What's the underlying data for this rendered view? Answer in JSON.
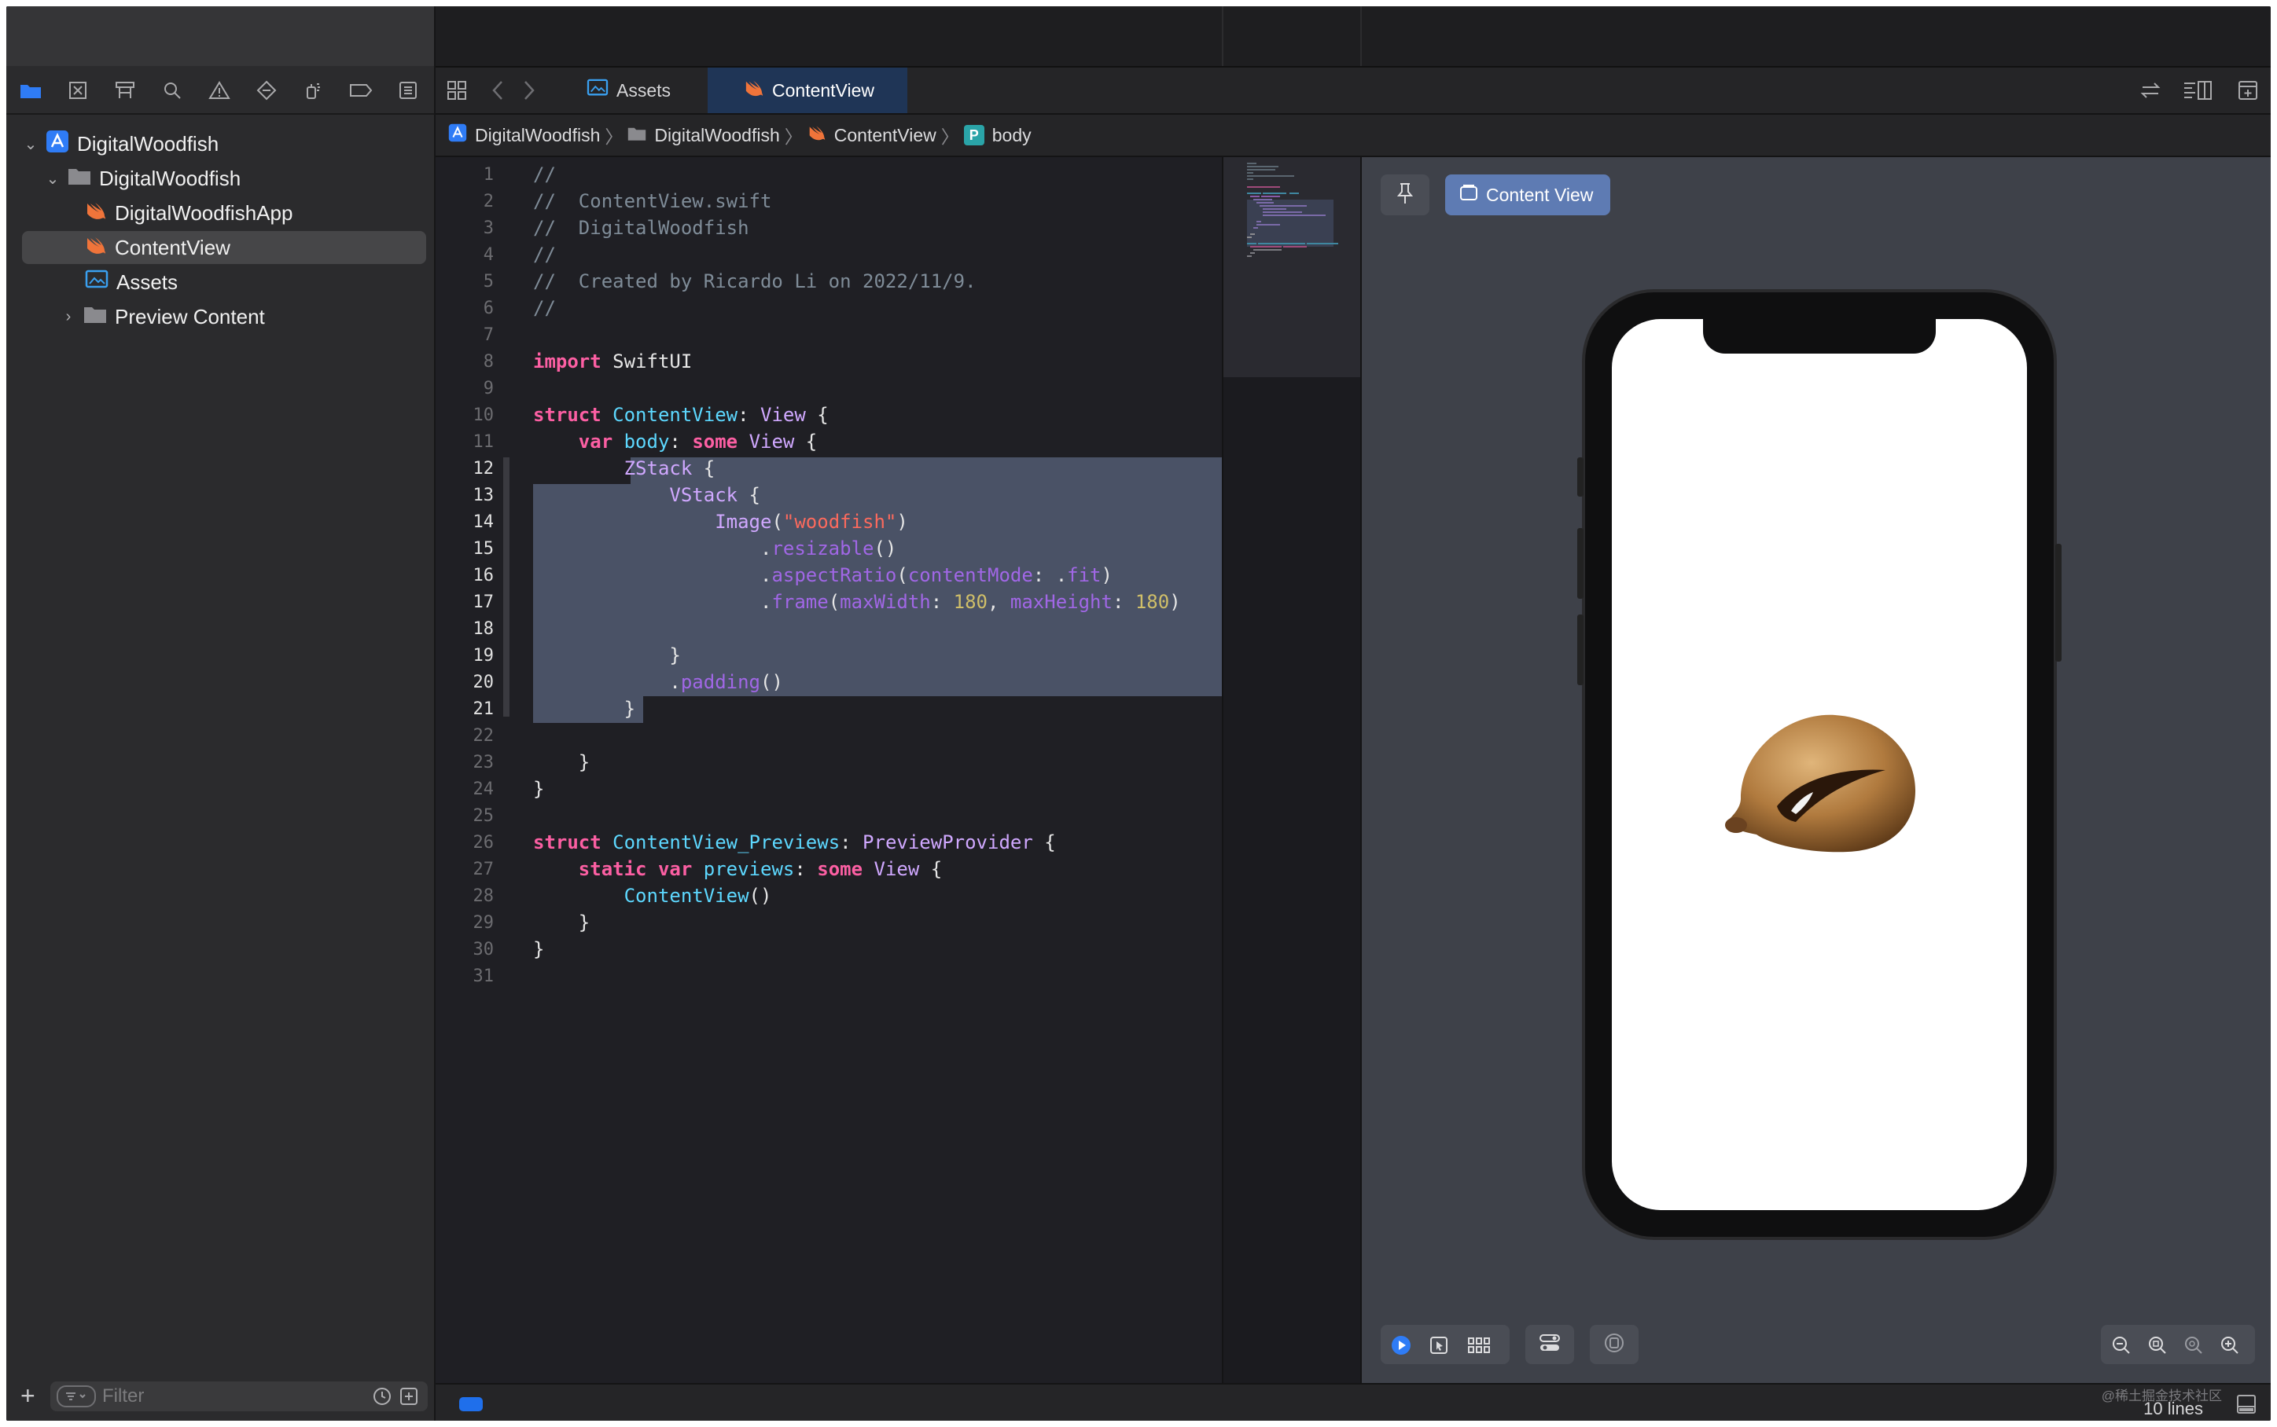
{
  "navigator": {
    "tools": [
      {
        "icon": "folder-icon",
        "symbol": "▬"
      },
      {
        "icon": "source-control-icon",
        "symbol": "⊠"
      },
      {
        "icon": "symbol-navigator-icon",
        "symbol": "⌸"
      },
      {
        "icon": "find-icon",
        "symbol": "⌕"
      },
      {
        "icon": "issue-warning-icon",
        "symbol": "⚠"
      },
      {
        "icon": "test-diamond-icon",
        "symbol": "◇"
      },
      {
        "icon": "debug-spray-icon",
        "symbol": "☄"
      },
      {
        "icon": "breakpoint-icon",
        "symbol": "▭"
      },
      {
        "icon": "report-icon",
        "symbol": "☰"
      }
    ],
    "tree": [
      {
        "label": "DigitalWoodfish",
        "icon": "project-icon",
        "chevron": "⌄"
      },
      {
        "label": "DigitalWoodfish",
        "icon": "folder-icon",
        "chevron": "⌄"
      },
      {
        "label": "DigitalWoodfishApp",
        "icon": "swift-file-icon",
        "chevron": ""
      },
      {
        "label": "ContentView",
        "icon": "swift-file-icon",
        "chevron": ""
      },
      {
        "label": "Assets",
        "icon": "asset-catalog-icon",
        "chevron": ""
      },
      {
        "label": "Preview Content",
        "icon": "folder-icon",
        "chevron": "›"
      }
    ],
    "filter_placeholder": "Filter",
    "add_symbol": "+"
  },
  "tabs": [
    {
      "label": "Assets",
      "icon": "asset-catalog-icon"
    },
    {
      "label": "ContentView",
      "icon": "swift-file-icon"
    }
  ],
  "jumpbar": {
    "items": [
      "DigitalWoodfish",
      "DigitalWoodfish",
      "ContentView",
      "body"
    ],
    "body_badge": "P",
    "separator": "〉"
  },
  "code": {
    "line_numbers": [
      "1",
      "2",
      "3",
      "4",
      "5",
      "6",
      "7",
      "8",
      "9",
      "10",
      "11",
      "12",
      "13",
      "14",
      "15",
      "16",
      "17",
      "18",
      "19",
      "20",
      "21",
      "22",
      "23",
      "24",
      "25",
      "26",
      "27",
      "28",
      "29",
      "30",
      "31"
    ],
    "tokens": {
      "l1": "//",
      "l2": "//  ContentView.swift",
      "l3": "//  DigitalWoodfish",
      "l4": "//",
      "l5": "//  Created by Ricardo Li on 2022/11/9.",
      "l6": "//",
      "import_kw": "import",
      "import_mod": " SwiftUI",
      "struct_kw": "struct",
      "cv_name": "ContentView",
      "colon": ":",
      "view_type": "View",
      "brace_open": " {",
      "var_kw": "var",
      "body_name": "body",
      "some_kw": "some",
      "zstack": "ZStack",
      "vstack": "VStack",
      "image_fn": "Image",
      "paren_open": "(",
      "woodfish_str": "\"woodfish\"",
      "paren_close": ")",
      "dot": ".",
      "resizable": "resizable",
      "call_empty": "()",
      "aspect_ratio": "aspectRatio",
      "content_mode": "contentMode",
      "fit": "fit",
      "frame": "frame",
      "max_width": "maxWidth",
      "max_height": "maxHeight",
      "n180a": "180",
      "n180b": "180",
      "comma": ",",
      "brace_close": "}",
      "padding": "padding",
      "previews_struct": "ContentView_Previews",
      "preview_provider": "PreviewProvider",
      "static_kw": "static",
      "previews_name": "previews",
      "cv_call": "ContentView"
    }
  },
  "preview": {
    "pin_icon": "pin-icon",
    "chip_label": "Content View",
    "bottom_tools": [
      "live-play-icon",
      "selectable-icon",
      "variants-grid-icon",
      "device-settings-icon",
      "info-icon"
    ],
    "zoom_tools": [
      "zoom-out-icon",
      "zoom-fit-icon",
      "zoom-actual-icon",
      "zoom-in-icon"
    ]
  },
  "status": {
    "lines": "10 lines",
    "watermark": "@稀土掘金技术社区"
  },
  "colors": {
    "accent": "#1f6feb",
    "selection": "#4a5266",
    "tab_active": "#1f3556",
    "swift_orange": "#f0743a"
  }
}
